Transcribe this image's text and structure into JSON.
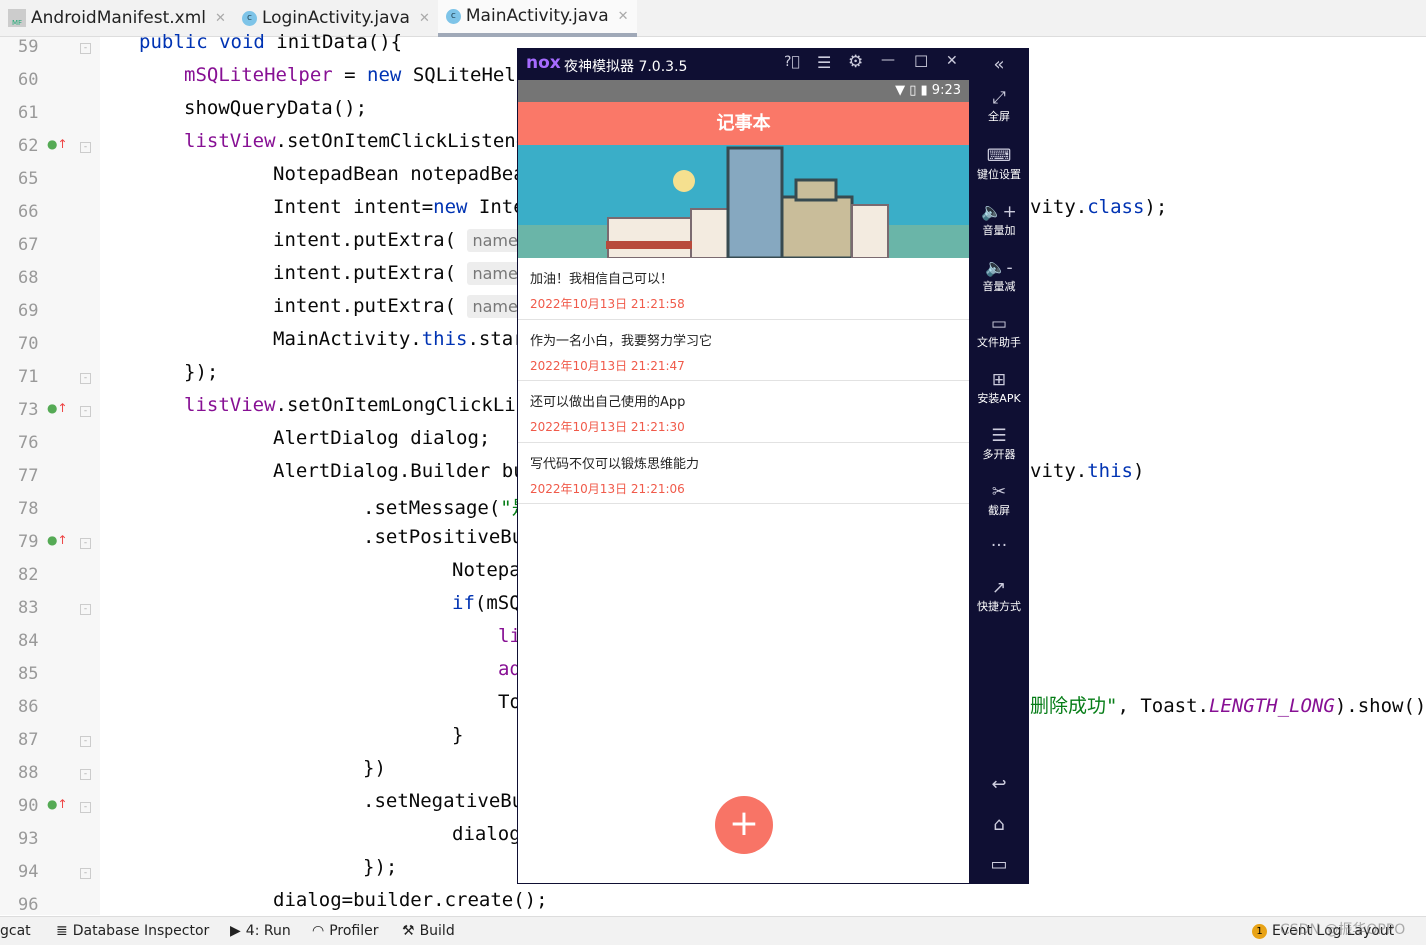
{
  "tabs": [
    {
      "label": "AndroidManifest.xml",
      "icon": "manifest-icon"
    },
    {
      "label": "LoginActivity.java",
      "icon": "class-icon"
    },
    {
      "label": "MainActivity.java",
      "icon": "class-icon",
      "active": true
    }
  ],
  "code_lines": [
    {
      "n": "59",
      "indent": 139,
      "segs": [
        [
          "k",
          "public void "
        ],
        [
          "",
          "initData(){"
        ]
      ],
      "fold": true
    },
    {
      "n": "60",
      "indent": 184,
      "segs": [
        [
          "f",
          "mSQLiteHelper"
        ],
        [
          "",
          " = "
        ],
        [
          "k",
          "new "
        ],
        [
          "",
          "SQLiteHelp"
        ]
      ]
    },
    {
      "n": "61",
      "indent": 184,
      "segs": [
        [
          "",
          "showQueryData();"
        ]
      ]
    },
    {
      "n": "62",
      "indent": 184,
      "segs": [
        [
          "f",
          "listView"
        ],
        [
          "",
          ".setOnItemClickListene"
        ]
      ],
      "mark": true,
      "fold": true
    },
    {
      "n": "65",
      "indent": 273,
      "segs": [
        [
          "",
          "NotepadBean notepadBea"
        ]
      ]
    },
    {
      "n": "66",
      "indent": 273,
      "segs": [
        [
          "",
          "Intent intent="
        ],
        [
          "k",
          "new "
        ],
        [
          "",
          "Inte"
        ]
      ],
      "right": [
        [
          "",
          "vity."
        ],
        [
          "k",
          "class"
        ],
        [
          "",
          ");"
        ]
      ]
    },
    {
      "n": "67",
      "indent": 273,
      "segs": [
        [
          "",
          "intent.putExtra( "
        ],
        [
          "hint",
          "name:"
        ]
      ]
    },
    {
      "n": "68",
      "indent": 273,
      "segs": [
        [
          "",
          "intent.putExtra( "
        ],
        [
          "hint",
          "name:"
        ]
      ]
    },
    {
      "n": "69",
      "indent": 273,
      "segs": [
        [
          "",
          "intent.putExtra( "
        ],
        [
          "hint",
          "name:"
        ]
      ]
    },
    {
      "n": "70",
      "indent": 273,
      "segs": [
        [
          "",
          "MainActivity."
        ],
        [
          "k",
          "this"
        ],
        [
          "",
          ".star"
        ]
      ]
    },
    {
      "n": "71",
      "indent": 184,
      "segs": [
        [
          "",
          "});"
        ]
      ],
      "fold": true
    },
    {
      "n": "73",
      "indent": 184,
      "segs": [
        [
          "f",
          "listView"
        ],
        [
          "",
          ".setOnItemLongClickLis"
        ]
      ],
      "mark": true,
      "fold": true
    },
    {
      "n": "76",
      "indent": 273,
      "segs": [
        [
          "",
          "AlertDialog dialog;"
        ]
      ]
    },
    {
      "n": "77",
      "indent": 273,
      "segs": [
        [
          "",
          "AlertDialog.Builder bu"
        ]
      ],
      "right": [
        [
          "",
          "vity."
        ],
        [
          "k",
          "this"
        ],
        [
          "",
          ")"
        ]
      ]
    },
    {
      "n": "78",
      "indent": 363,
      "segs": [
        [
          "",
          ".setMessage("
        ],
        [
          "s",
          "\"是"
        ]
      ]
    },
    {
      "n": "79",
      "indent": 363,
      "segs": [
        [
          "",
          ".setPositiveBu"
        ]
      ],
      "mark": true,
      "fold": true
    },
    {
      "n": "82",
      "indent": 452,
      "segs": [
        [
          "",
          "Notepa"
        ]
      ]
    },
    {
      "n": "83",
      "indent": 452,
      "segs": [
        [
          "k",
          "if"
        ],
        [
          "",
          "(mSQ"
        ]
      ],
      "fold": true
    },
    {
      "n": "84",
      "indent": 498,
      "segs": [
        [
          "f",
          "li"
        ]
      ]
    },
    {
      "n": "85",
      "indent": 498,
      "segs": [
        [
          "f",
          "ad"
        ]
      ]
    },
    {
      "n": "86",
      "indent": 498,
      "segs": [
        [
          "",
          "To"
        ]
      ],
      "right": [
        [
          "s",
          "删除成功\""
        ],
        [
          "",
          ", Toast."
        ],
        [
          "i",
          "LENGTH_LONG"
        ],
        [
          "",
          ").show();"
        ]
      ]
    },
    {
      "n": "87",
      "indent": 452,
      "segs": [
        [
          "",
          "}"
        ]
      ],
      "fold": true
    },
    {
      "n": "88",
      "indent": 363,
      "segs": [
        [
          "",
          "})"
        ]
      ],
      "fold": true
    },
    {
      "n": "90",
      "indent": 363,
      "segs": [
        [
          "",
          ".setNegativeBu"
        ]
      ],
      "mark": true,
      "fold": true
    },
    {
      "n": "93",
      "indent": 452,
      "segs": [
        [
          "",
          "dialog"
        ]
      ]
    },
    {
      "n": "94",
      "indent": 363,
      "segs": [
        [
          "",
          "});"
        ]
      ],
      "fold": true
    },
    {
      "n": "96",
      "indent": 273,
      "segs": [
        [
          "",
          "dialog=builder.create();"
        ]
      ]
    }
  ],
  "emulator": {
    "logo": "nox",
    "title": "夜神模拟器 7.0.3.5",
    "status_time": "9:23",
    "app_title": "记事本",
    "notes": [
      {
        "text": "加油！我相信自己可以！",
        "time": "2022年10月13日 21:21:58"
      },
      {
        "text": "作为一名小白，我要努力学习它",
        "time": "2022年10月13日 21:21:47"
      },
      {
        "text": "还可以做出自己使用的App",
        "time": "2022年10月13日 21:21:30"
      },
      {
        "text": "写代码不仅可以锻炼思维能力",
        "time": "2022年10月13日 21:21:06"
      }
    ],
    "fab": "+",
    "sidebar": [
      {
        "label": "全屏",
        "g": "⤢"
      },
      {
        "label": "键位设置",
        "g": "⌨"
      },
      {
        "label": "音量加",
        "g": "🔈+"
      },
      {
        "label": "音量减",
        "g": "🔈-"
      },
      {
        "label": "文件助手",
        "g": "▭"
      },
      {
        "label": "安装APK",
        "g": "⊞"
      },
      {
        "label": "多开器",
        "g": "☰"
      },
      {
        "label": "截屏",
        "g": "✂"
      },
      {
        "label": "",
        "g": "···"
      },
      {
        "label": "快捷方式",
        "g": "↗"
      }
    ],
    "accent": "#fa7868"
  },
  "bottom": {
    "logcat": "gcat",
    "db": "Database Inspector",
    "run": "4: Run",
    "profiler": "Profiler",
    "build": "Build",
    "event_count": "1",
    "event": "Event Log",
    "layout": "Layout",
    "watermark": "CSDN @振华OPPO"
  }
}
